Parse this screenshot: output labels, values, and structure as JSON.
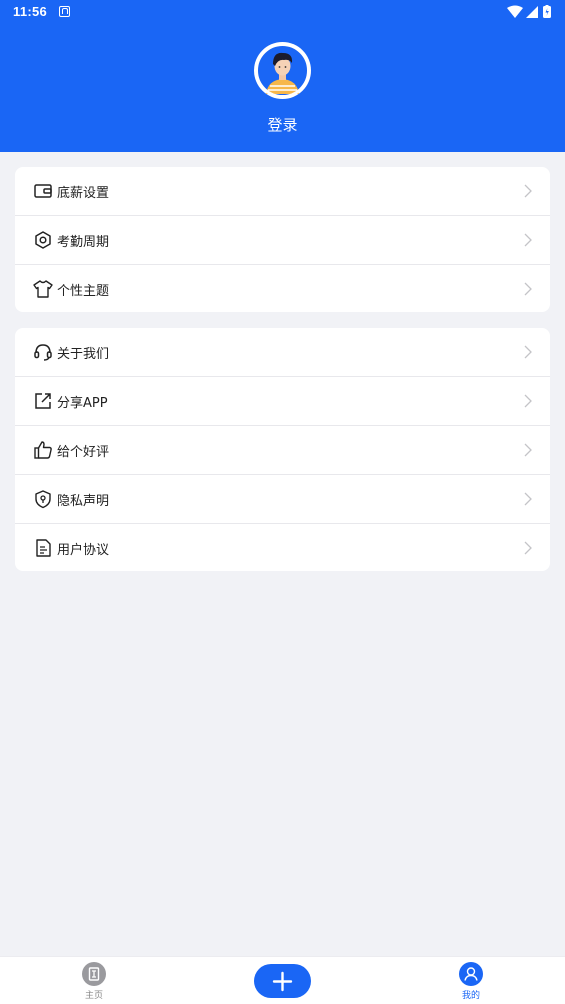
{
  "status_bar": {
    "time": "11:56"
  },
  "profile": {
    "login_label": "登录"
  },
  "menu_group_1": [
    {
      "label": "底薪设置",
      "icon": "wallet-icon"
    },
    {
      "label": "考勤周期",
      "icon": "hexagon-settings-icon"
    },
    {
      "label": "个性主题",
      "icon": "tshirt-icon"
    }
  ],
  "menu_group_2": [
    {
      "label": "关于我们",
      "icon": "headset-icon"
    },
    {
      "label": "分享APP",
      "icon": "share-icon"
    },
    {
      "label": "给个好评",
      "icon": "thumbs-up-icon"
    },
    {
      "label": "隐私声明",
      "icon": "shield-icon"
    },
    {
      "label": "用户协议",
      "icon": "document-icon"
    }
  ],
  "tabbar": {
    "home_label": "主页",
    "mine_label": "我的"
  },
  "colors": {
    "brand": "#1a66f5",
    "background": "#f1f2f6"
  }
}
